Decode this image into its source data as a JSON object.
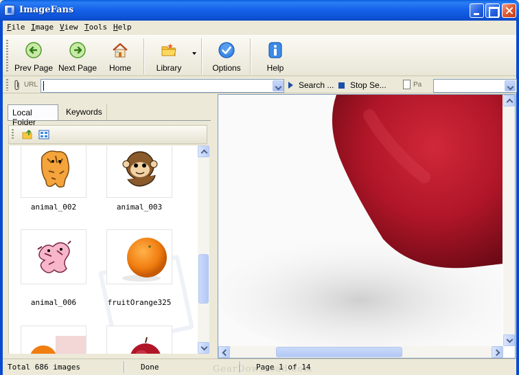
{
  "window": {
    "title": "ImageFans"
  },
  "menu": [
    "File",
    "Image",
    "View",
    "Tools",
    "Help"
  ],
  "toolbar": {
    "prev_label": "Prev Page",
    "next_label": "Next Page",
    "home_label": "Home",
    "library_label": "Library",
    "options_label": "Options",
    "help_label": "Help",
    "icons": [
      "back-arrow-icon",
      "forward-arrow-icon",
      "house-icon",
      "folder-icon",
      "checkmark-icon",
      "info-icon"
    ]
  },
  "address": {
    "url_label": "URL",
    "url_value": "",
    "search_label": "Search ...",
    "stop_label": "Stop Se...",
    "page_label": "Pa",
    "page_value": ""
  },
  "left_panel": {
    "tabs": [
      "Local Folder",
      "Keywords"
    ],
    "thumbnails": [
      {
        "name": "animal_002",
        "icon": "tiger-cartoon"
      },
      {
        "name": "animal_003",
        "icon": "monkey-cartoon"
      },
      {
        "name": "animal_006",
        "icon": "dragon-cartoon"
      },
      {
        "name": "fruitOrange325",
        "icon": "orange-photo"
      },
      {
        "name": "",
        "icon": "orange-photo-partial"
      },
      {
        "name": "",
        "icon": "apple-photo-partial"
      }
    ]
  },
  "preview": {
    "subject": "red apple photo"
  },
  "status": {
    "total": "Total 686 images",
    "state": "Done",
    "page": "Page 1 of 14",
    "watermark": "GearDownload.com"
  },
  "colors": {
    "titlebar": "#0a5fdc",
    "apple_red": "#b01628",
    "orange": "#f07d10"
  }
}
